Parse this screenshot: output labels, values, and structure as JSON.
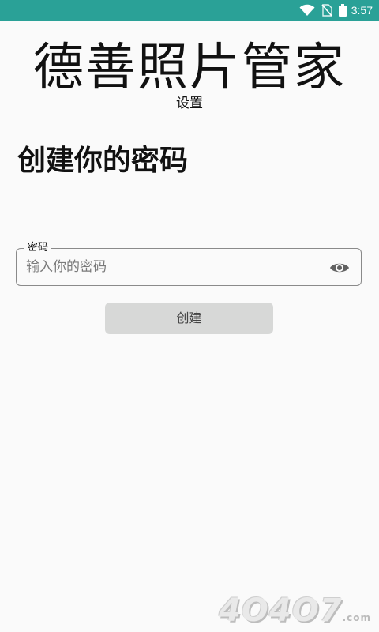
{
  "status_bar": {
    "time": "3:57",
    "icons": [
      "wifi-icon",
      "no-sim-icon",
      "battery-icon"
    ],
    "background": "#2aa197"
  },
  "header": {
    "app_title": "德善照片管家",
    "subtitle": "设置"
  },
  "main": {
    "heading": "创建你的密码",
    "password_field": {
      "label": "密码",
      "placeholder": "输入你的密码",
      "value": "",
      "toggle_icon": "eye-icon"
    },
    "create_button": {
      "label": "创建",
      "background": "#d7d8d7"
    }
  },
  "watermark": {
    "text": "4O4O7",
    "suffix": ".com"
  }
}
